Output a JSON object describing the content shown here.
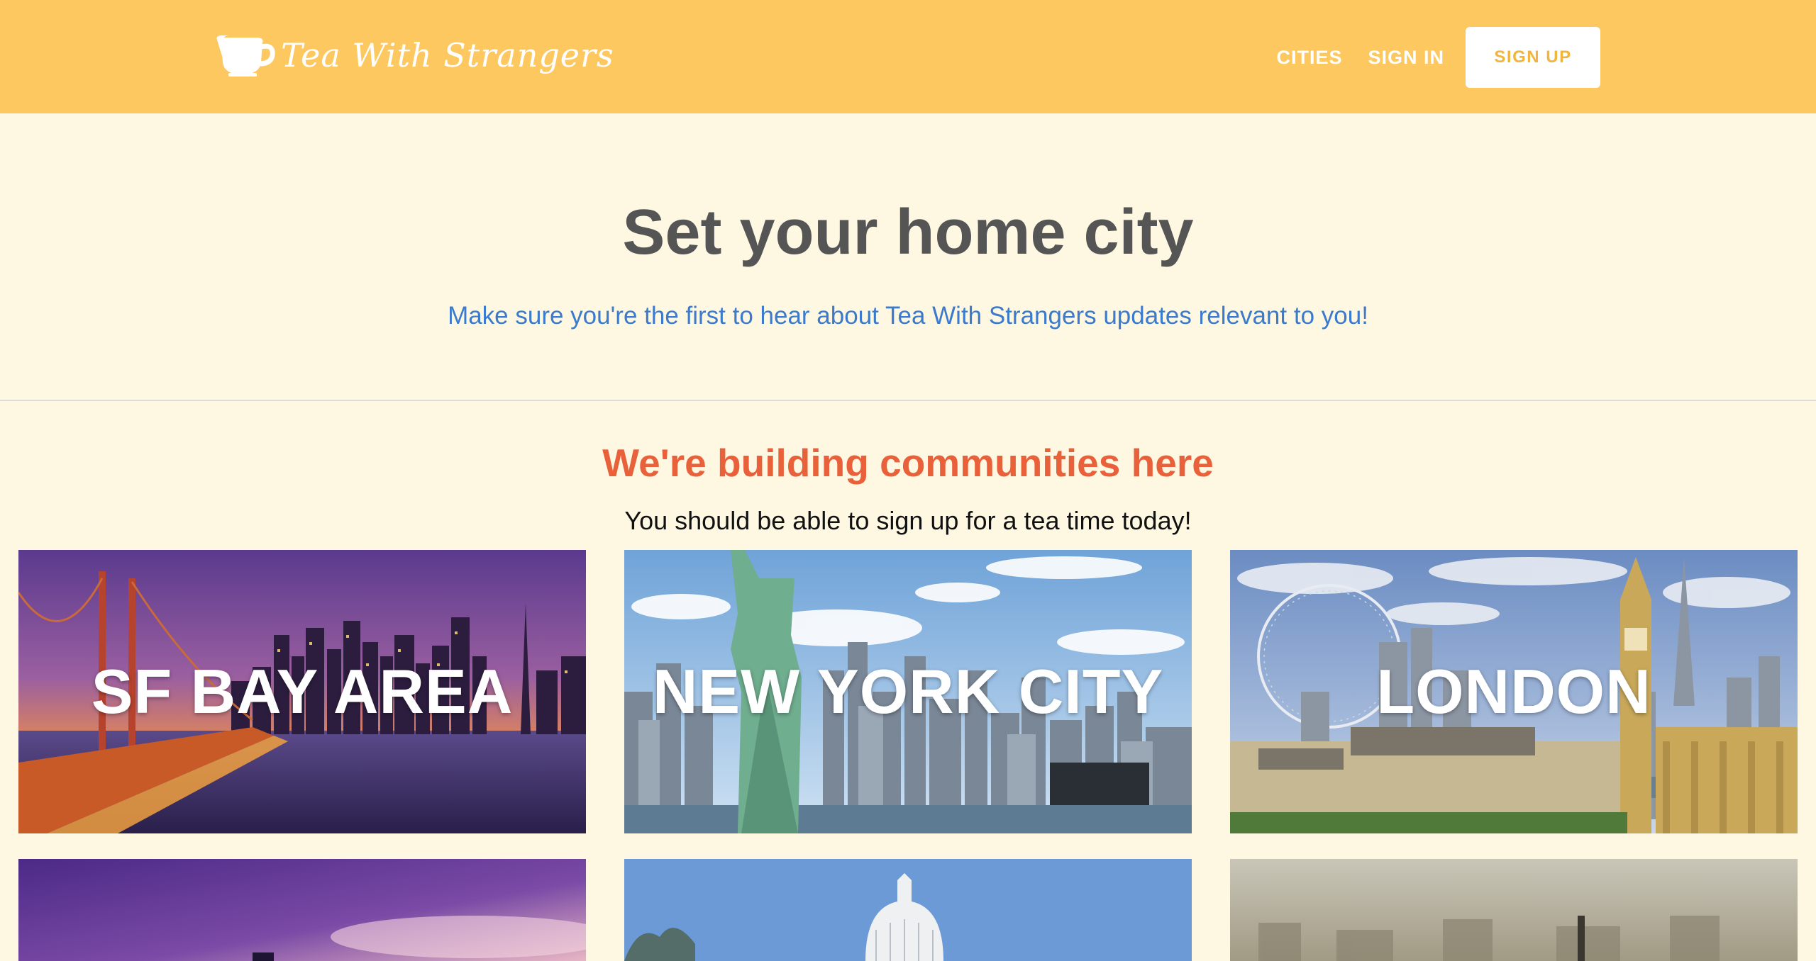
{
  "header": {
    "brand_name": "Tea With Strangers",
    "brand_icon": "teacup-icon",
    "nav": {
      "cities": "CITIES",
      "sign_in": "SIGN IN",
      "sign_up": "SIGN UP"
    }
  },
  "hero": {
    "title": "Set your home city",
    "subtitle": "Make sure you're the first to hear about Tea With Strangers updates relevant to you!"
  },
  "communities": {
    "title": "We're building communities here",
    "subtitle": "You should be able to sign up for a tea time today!",
    "cities": [
      {
        "name": "SF BAY AREA",
        "image": "golden-gate-night-photo"
      },
      {
        "name": "NEW YORK CITY",
        "image": "statue-of-liberty-skyline-photo"
      },
      {
        "name": "LONDON",
        "image": "london-eye-big-ben-photo"
      }
    ],
    "more_cities": [
      {
        "image": "purple-sunset-skyline-photo"
      },
      {
        "image": "capitol-dome-photo"
      },
      {
        "image": "hazy-city-aerial-photo"
      }
    ]
  },
  "colors": {
    "header_bg": "#fdc85f",
    "page_bg": "#fef8e3",
    "title": "#555555",
    "subtitle_link": "#3b7acc",
    "section_title": "#e8613a",
    "signup_text": "#f2b53c"
  }
}
